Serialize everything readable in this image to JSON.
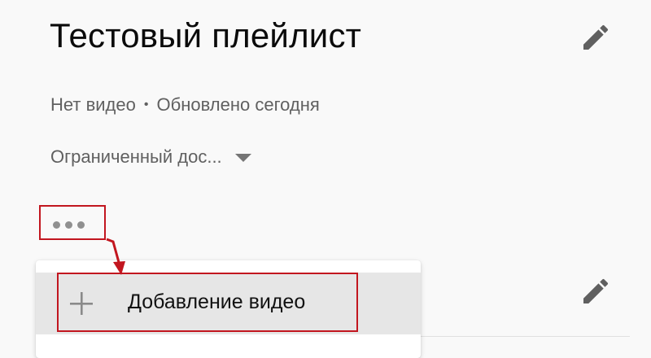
{
  "playlist": {
    "title": "Тестовый плейлист",
    "video_count": "Нет видео",
    "separator": "•",
    "updated": "Обновлено сегодня",
    "privacy": "Ограниченный дос..."
  },
  "menu": {
    "items": [
      {
        "label": "Добавление видео",
        "icon": "plus-icon"
      }
    ]
  },
  "icons": {
    "edit": "pencil-icon",
    "more": "more-horiz-icon",
    "privacy_dropdown": "caret-down-icon"
  },
  "colors": {
    "annotation": "#c2161f",
    "secondary_text": "#606060",
    "icon_gray": "#606060",
    "menu_hover": "#e6e6e6"
  }
}
